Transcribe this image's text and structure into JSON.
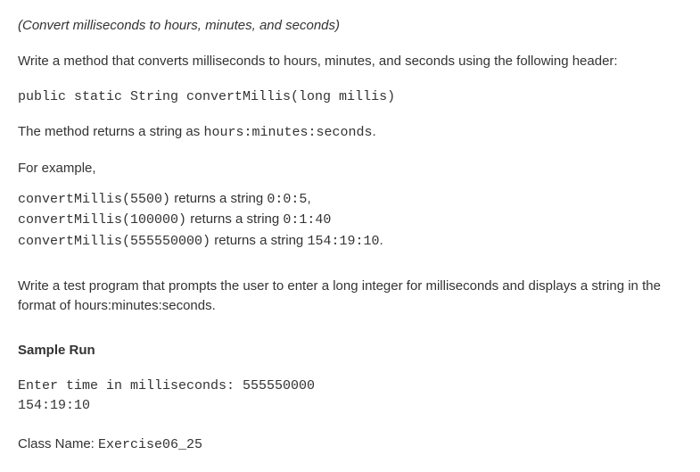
{
  "title": "(Convert milliseconds to hours, minutes, and seconds)",
  "intro": "Write a method that converts milliseconds to hours, minutes, and seconds using the following header:",
  "method_signature": "public static String convertMillis(long millis)",
  "returns_prefix": "The method returns a string as ",
  "returns_format": "hours:minutes:seconds",
  "returns_suffix": ".",
  "for_example": "For example,",
  "examples": [
    {
      "call": "convertMillis(5500)",
      "mid": " returns a string ",
      "result": "0:0:5",
      "tail": ","
    },
    {
      "call": "convertMillis(100000)",
      "mid": "  returns a string ",
      "result": "0:1:40",
      "tail": ""
    },
    {
      "call": "convertMillis(555550000)",
      "mid": "  returns a string ",
      "result": "154:19:10",
      "tail": "."
    }
  ],
  "test_program": "Write a test program that prompts the user to enter a long integer for milliseconds and displays a string in the format of hours:minutes:seconds.",
  "sample_run_heading": "Sample Run",
  "sample_run_lines": [
    "Enter time in milliseconds: 555550000",
    "154:19:10"
  ],
  "class_name_label": "Class Name: ",
  "class_name_value": "Exercise06_25"
}
